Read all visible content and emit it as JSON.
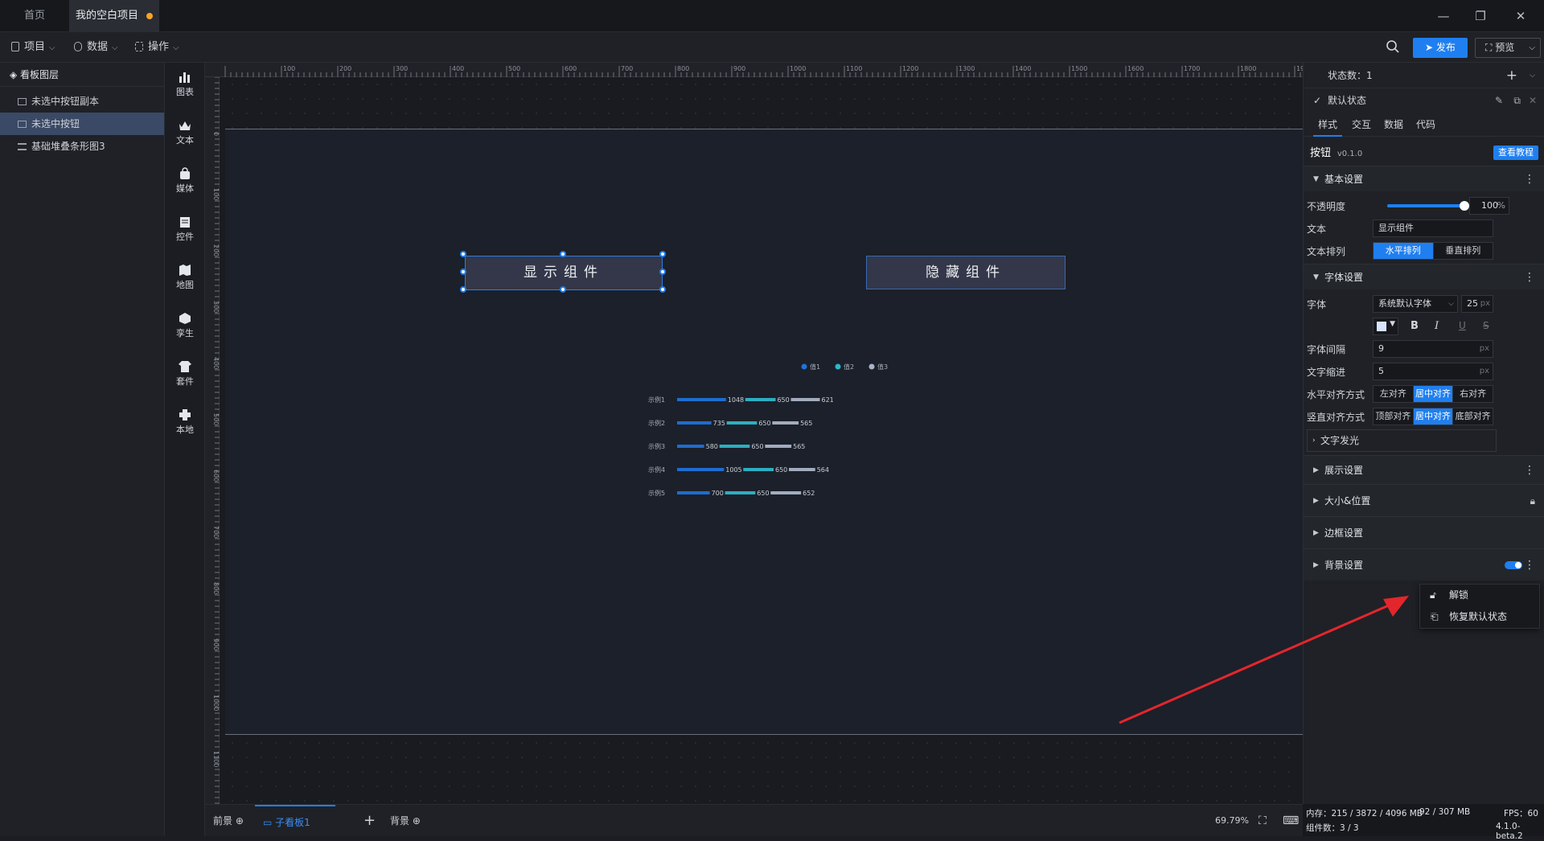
{
  "titlebar": {
    "tabs": [
      {
        "label": "首页"
      },
      {
        "label": "我的空白项目"
      }
    ],
    "window_controls": [
      "minimize-icon",
      "restore-icon",
      "close-icon"
    ]
  },
  "menubar": {
    "items": [
      {
        "label": "项目"
      },
      {
        "label": "数据"
      },
      {
        "label": "操作"
      }
    ],
    "publish_label": "发布",
    "preview_label": "预览"
  },
  "layers": {
    "title": "看板图层",
    "items": [
      {
        "label": "未选中按钮副本",
        "selected": false
      },
      {
        "label": "未选中按钮",
        "selected": true
      },
      {
        "label": "基础堆叠条形图3",
        "selected": false
      }
    ]
  },
  "toolbox": {
    "items": [
      {
        "label": "图表",
        "icon": "chart-icon"
      },
      {
        "label": "文本",
        "icon": "text-icon"
      },
      {
        "label": "媒体",
        "icon": "media-icon"
      },
      {
        "label": "控件",
        "icon": "control-icon"
      },
      {
        "label": "地图",
        "icon": "map-icon"
      },
      {
        "label": "孪生",
        "icon": "twin-icon"
      },
      {
        "label": "套件",
        "icon": "kit-icon"
      },
      {
        "label": "本地",
        "icon": "local-icon"
      }
    ]
  },
  "rulers": {
    "horizontal": [
      "100",
      "200",
      "300",
      "400",
      "500",
      "600",
      "700",
      "800",
      "900",
      "1000",
      "1100",
      "1200",
      "1300",
      "1400",
      "1500",
      "1600",
      "1700",
      "1800",
      "1900"
    ],
    "vertical": [
      "0",
      "100",
      "200",
      "300",
      "400",
      "500",
      "600",
      "700",
      "800",
      "900",
      "1000",
      "1100",
      "1200"
    ]
  },
  "canvas": {
    "show_button_text": "显示组件",
    "hide_button_text": "隐藏组件",
    "colors": {
      "button_bg": "#333749",
      "selection": "#1f7ff0",
      "canvas_bg": "#1b202a"
    }
  },
  "chart_data": {
    "type": "bar",
    "orientation": "horizontal",
    "stacked": true,
    "categories": [
      "示例1",
      "示例2",
      "示例3",
      "示例4",
      "示例5"
    ],
    "series": [
      {
        "name": "值1",
        "values": [
          1048,
          735,
          580,
          1005,
          700
        ],
        "color": "#1f72d8"
      },
      {
        "name": "值2",
        "values": [
          650,
          650,
          650,
          650,
          650
        ],
        "color": "#2fb6c9"
      },
      {
        "name": "值3",
        "values": [
          621,
          565,
          565,
          564,
          652
        ],
        "color": "#aab4c6"
      }
    ],
    "legend_position": "top-right",
    "grid": false
  },
  "bottombar": {
    "foreground_label": "前景",
    "sub_board_label": "子看板1",
    "background_label": "背景",
    "zoom": "69.79%"
  },
  "props": {
    "state_count_label": "状态数：1",
    "default_state_label": "默认状态",
    "tabs": [
      "样式",
      "交互",
      "数据",
      "代码"
    ],
    "active_tab": "样式",
    "component_name": "按钮",
    "component_version": "v0.1.0",
    "tutorial_label": "查看教程",
    "basic_section": "基本设置",
    "opacity_label": "不透明度",
    "opacity_value": "100",
    "opacity_unit": "%",
    "opacity_fraction": 1.0,
    "text_label": "文本",
    "text_value": "显示组件",
    "text_layout_label": "文本排列",
    "text_layout_options": [
      "水平排列",
      "垂直排列"
    ],
    "text_layout_selected": "水平排列",
    "font_section": "字体设置",
    "font_label": "字体",
    "font_value": "系统默认字体",
    "font_size": "25",
    "font_size_unit": "px",
    "font_color": "#d8e4ff",
    "bold_label": "B",
    "italic_label": "I",
    "underline_label": "U",
    "strike_label": "S",
    "letter_spacing_label": "字体间隔",
    "letter_spacing_value": "9",
    "letter_spacing_unit": "px",
    "indent_label": "文字缩进",
    "indent_value": "5",
    "indent_unit": "px",
    "h_align_label": "水平对齐方式",
    "h_align_options": [
      "左对齐",
      "居中对齐",
      "右对齐"
    ],
    "h_align_selected": "居中对齐",
    "v_align_label": "竖直对齐方式",
    "v_align_options": [
      "顶部对齐",
      "居中对齐",
      "底部对齐"
    ],
    "v_align_selected": "居中对齐",
    "glow_label": "文字发光",
    "display_section": "展示设置",
    "size_position_section": "大小&位置",
    "border_section": "边框设置",
    "background_section": "背景设置"
  },
  "context_menu": {
    "items": [
      {
        "label": "解锁",
        "icon": "unlock-icon"
      },
      {
        "label": "恢复默认状态",
        "icon": "restore-default-icon"
      }
    ]
  },
  "status": {
    "memory": "内存：215 / 3872 / 4096 MB",
    "gpu": "92 / 307 MB",
    "fps": "FPS：60",
    "components": "组件数：3 / 3",
    "version": "4.1.0-beta.2"
  }
}
